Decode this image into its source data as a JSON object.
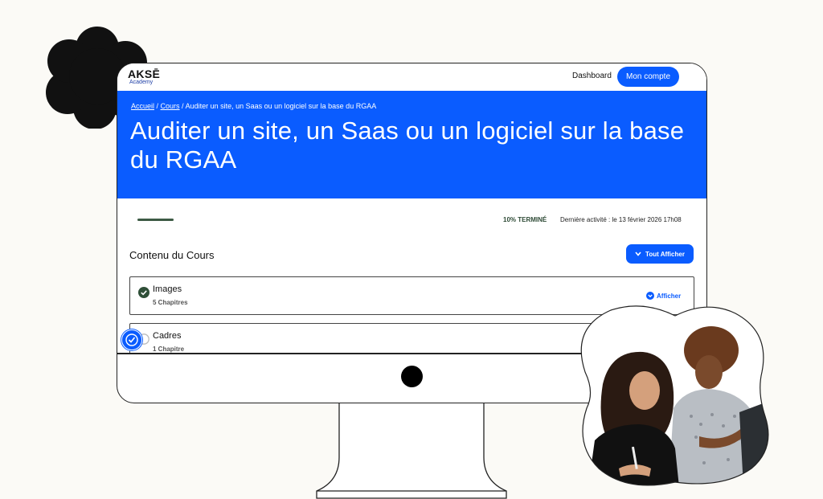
{
  "brand": {
    "name": "AKSĒ",
    "sub": "Academy"
  },
  "header": {
    "dashboard_label": "Dashboard",
    "account_label": "Mon compte"
  },
  "breadcrumb": {
    "home": "Accueil",
    "courses": "Cours",
    "current": "Auditer un site, un Saas ou un logiciel sur la base du RGAA",
    "separator": " / "
  },
  "course": {
    "title": "Auditer un site, un Saas ou un logiciel sur la base du RGAA",
    "progress_percent": 10,
    "progress_label": "10% TERMINÉ",
    "last_activity": "Dernière activité : le 13 février 2026 17h08"
  },
  "content": {
    "section_title": "Contenu du Cours",
    "show_all_label": "Tout Afficher",
    "modules": [
      {
        "title": "Images",
        "count": "5 Chapitres",
        "completed": true,
        "action_label": "Afficher"
      },
      {
        "title": "Cadres",
        "count": "1 Chapitre",
        "completed": false
      }
    ]
  },
  "colors": {
    "accent": "#0a5cff",
    "progress": "#3d5b45",
    "background": "#fbfaf6"
  },
  "icons": [
    "flower-decoration",
    "check-circle-icon",
    "chevron-down-icon",
    "accessibility-icon",
    "camera-dot"
  ]
}
